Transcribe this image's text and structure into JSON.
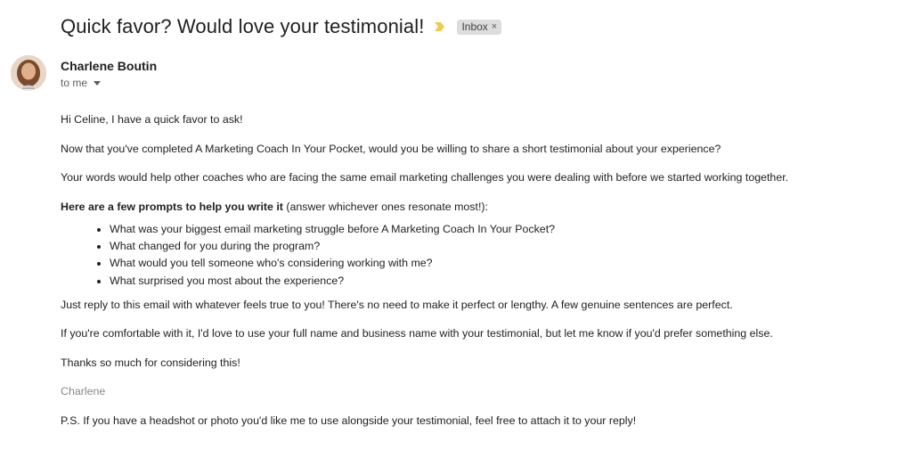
{
  "email": {
    "subject": "Quick favor? Would love your testimonial!",
    "label_chip": "Inbox",
    "label_chip_close": "×",
    "sender_name": "Charlene Boutin",
    "recipient_line": "to me",
    "colors": {
      "importance_marker": "#f2c94c",
      "chip_bg": "#dddddd"
    },
    "icons": {
      "importance": "importance-marker-icon",
      "recipient_caret": "caret-down-icon",
      "avatar": "sender-avatar"
    }
  },
  "body": {
    "greeting": "Hi Celine, I have a quick favor to ask!",
    "p1": "Now that you've completed A Marketing Coach In Your Pocket, would you be willing to share a short testimonial about your experience?",
    "p2": "Your words would help other coaches who are facing the same email marketing challenges you were dealing with before we started working together.",
    "prompts_bold": "Here are a few prompts to help you write it",
    "prompts_rest": " (answer whichever ones resonate most!):",
    "bullets": [
      "What was your biggest email marketing struggle before A Marketing Coach In Your Pocket?",
      "What changed for you during the program?",
      "What would you tell someone who's considering working with me?",
      "What surprised you most about the experience?"
    ],
    "p3": "Just reply to this email with whatever feels true to you! There's no need to make it perfect or lengthy. A few genuine sentences are perfect.",
    "p4": "If you're comfortable with it, I'd love to use your full name and business name with your testimonial, but let me know if you'd prefer something else.",
    "p5": "Thanks so much for considering this!",
    "signature": "Charlene",
    "ps": "P.S. If you have a headshot or photo you'd like me to use alongside your testimonial, feel free to attach it to your reply!"
  }
}
